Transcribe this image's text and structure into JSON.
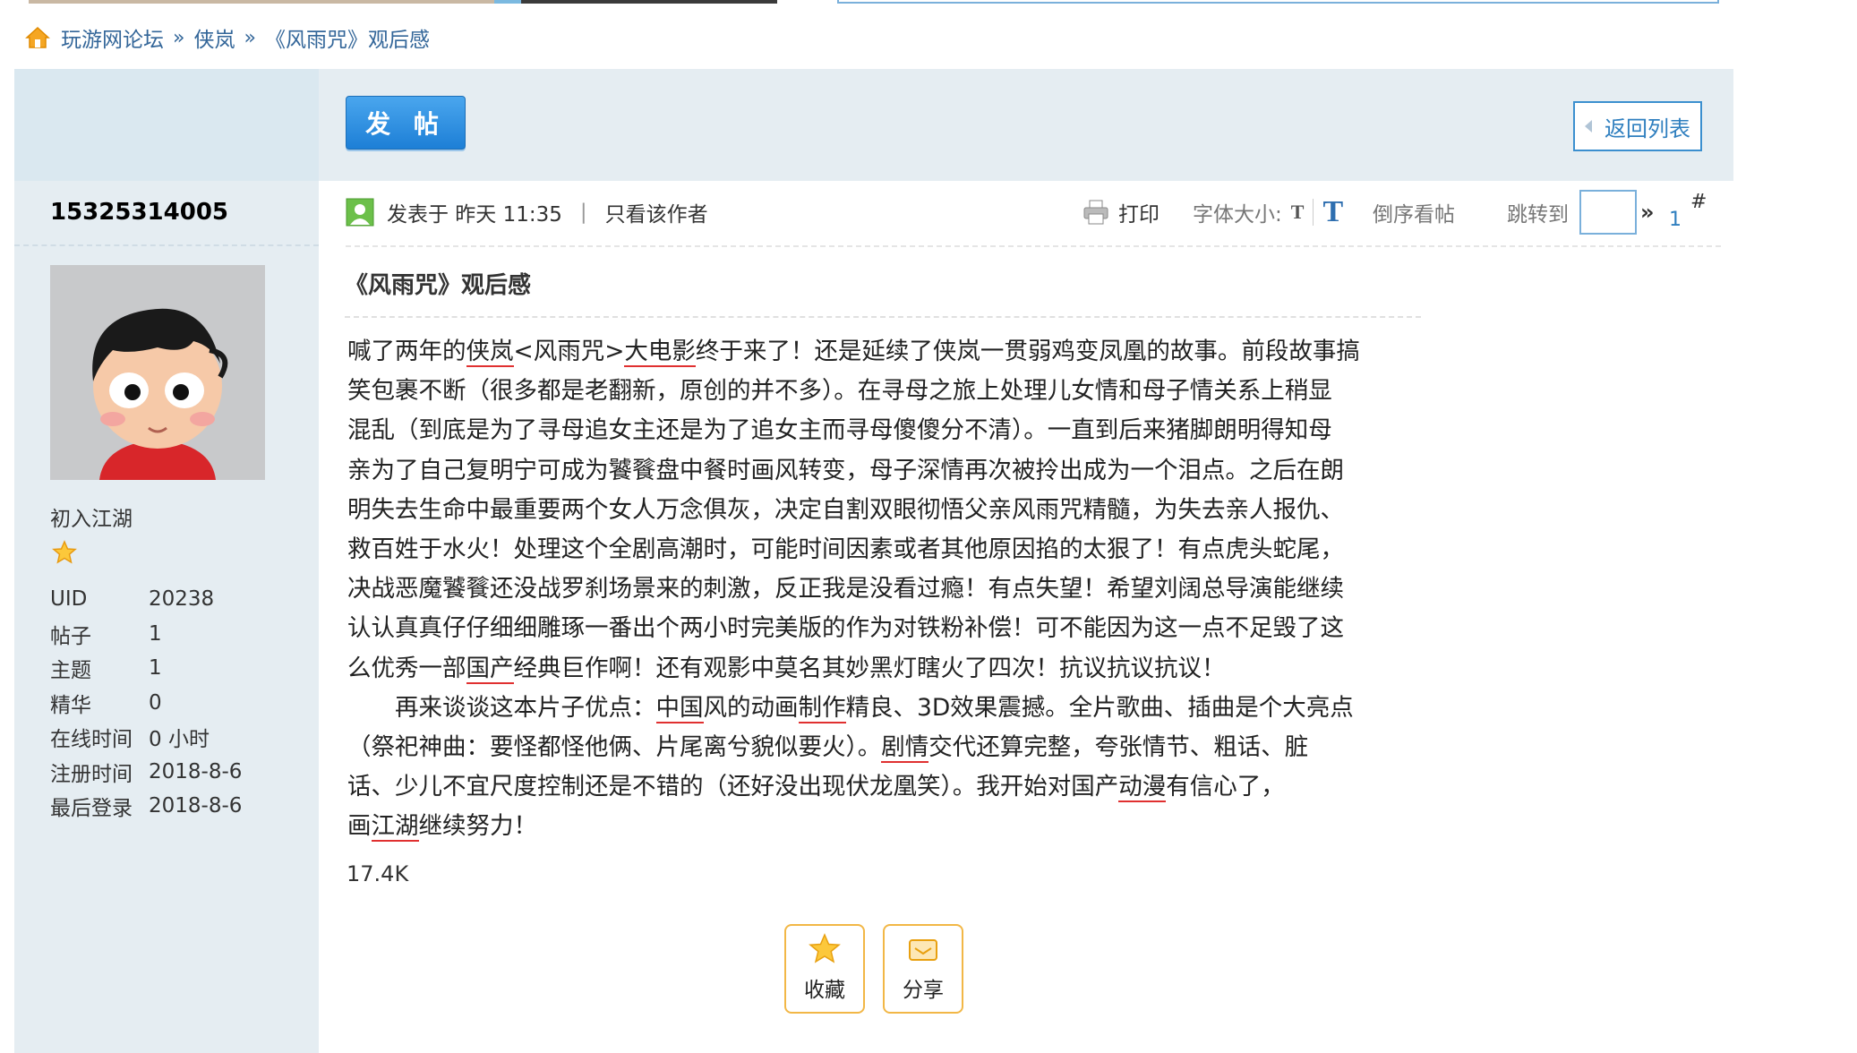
{
  "breadcrumb": {
    "items": [
      "玩游网论坛",
      "侠岚",
      "《风雨咒》观后感"
    ],
    "separator": "»"
  },
  "toolbar": {
    "post_label": "发 帖",
    "back_label": "返回列表"
  },
  "author": {
    "username": "15325314005",
    "rank": "初入江湖",
    "stats": [
      {
        "key": "UID",
        "value": "20238"
      },
      {
        "key": "帖子",
        "value": "1"
      },
      {
        "key": "主题",
        "value": "1"
      },
      {
        "key": "精华",
        "value": "0"
      },
      {
        "key": "在线时间",
        "value": "0 小时"
      },
      {
        "key": "注册时间",
        "value": "2018-8-6"
      },
      {
        "key": "最后登录",
        "value": "2018-8-6"
      }
    ]
  },
  "post_meta": {
    "posted_at": "发表于 昨天 11:35",
    "only_author": "只看该作者",
    "print": "打印",
    "font_size_label": "字体大小:",
    "font_small": "T",
    "font_big": "T",
    "reverse": "倒序看帖",
    "jump_label": "跳转到",
    "jump_arrow": "»",
    "floor_num": "1",
    "floor_hash": "#"
  },
  "post": {
    "title": "《风雨咒》观后感",
    "size": "17.4K"
  },
  "actions": {
    "favorite": "收藏",
    "share": "分享"
  },
  "colors": {
    "link": "#336699",
    "accent_blue": "#1d7fd6",
    "sidebar_bg": "#e5edf2",
    "action_border": "#f2b746"
  }
}
